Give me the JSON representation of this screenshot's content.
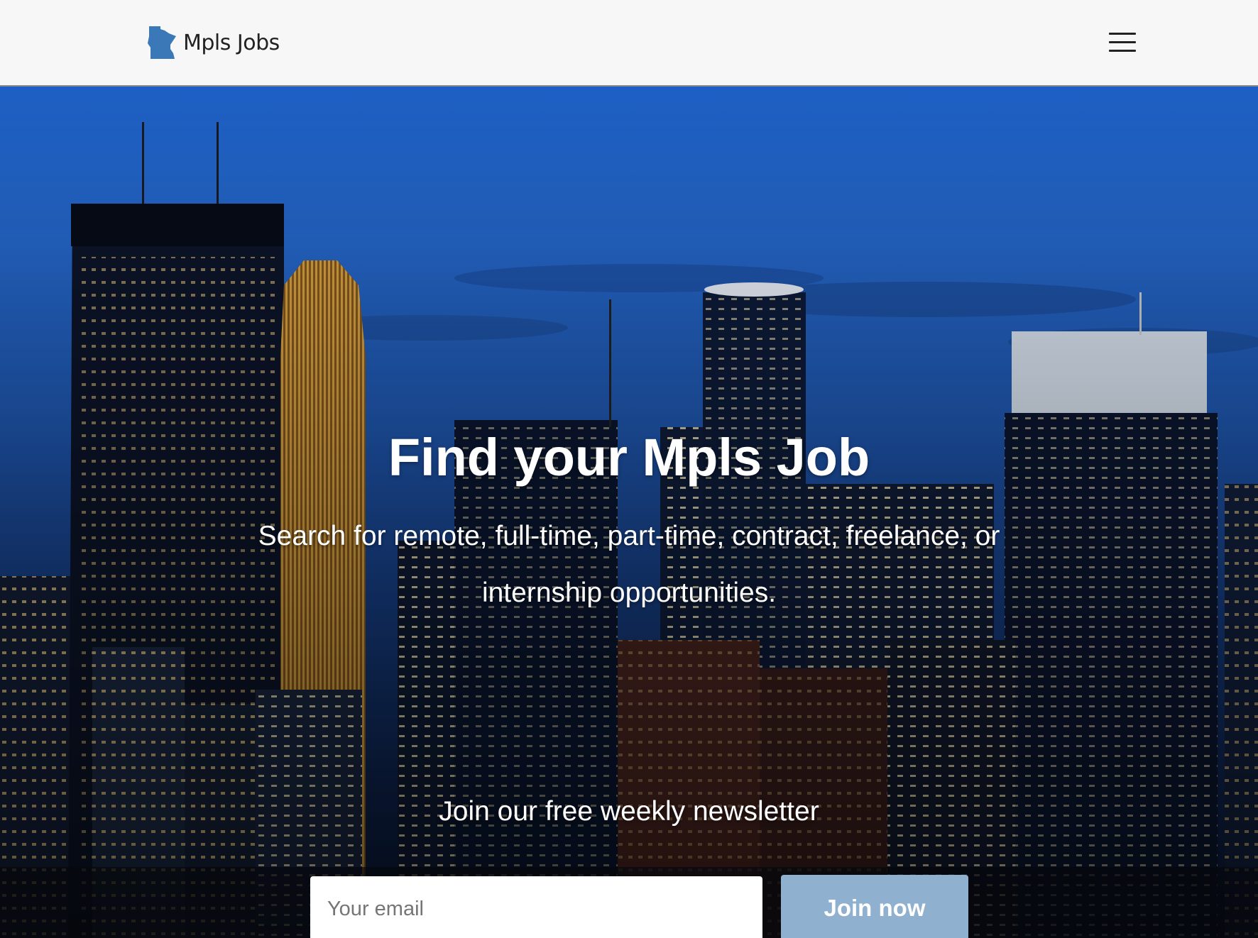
{
  "header": {
    "brand_name": "Mpls Jobs",
    "logo_icon": "minnesota-state-icon",
    "menu_icon": "hamburger-menu-icon"
  },
  "hero": {
    "title": "Find your Mpls Job",
    "subtitle": "Search for remote, full-time, part-time, contract, freelance, or internship opportunities.",
    "background": "Minneapolis skyline at dusk",
    "newsletter": {
      "title": "Join our free weekly newsletter",
      "email_placeholder": "Your email",
      "email_value": "",
      "button_label": "Join now"
    }
  },
  "colors": {
    "navbar_bg": "#f7f7f7",
    "button_bg": "#8fb0cf",
    "hero_text": "#ffffff",
    "logo_blue": "#3a78b8"
  }
}
